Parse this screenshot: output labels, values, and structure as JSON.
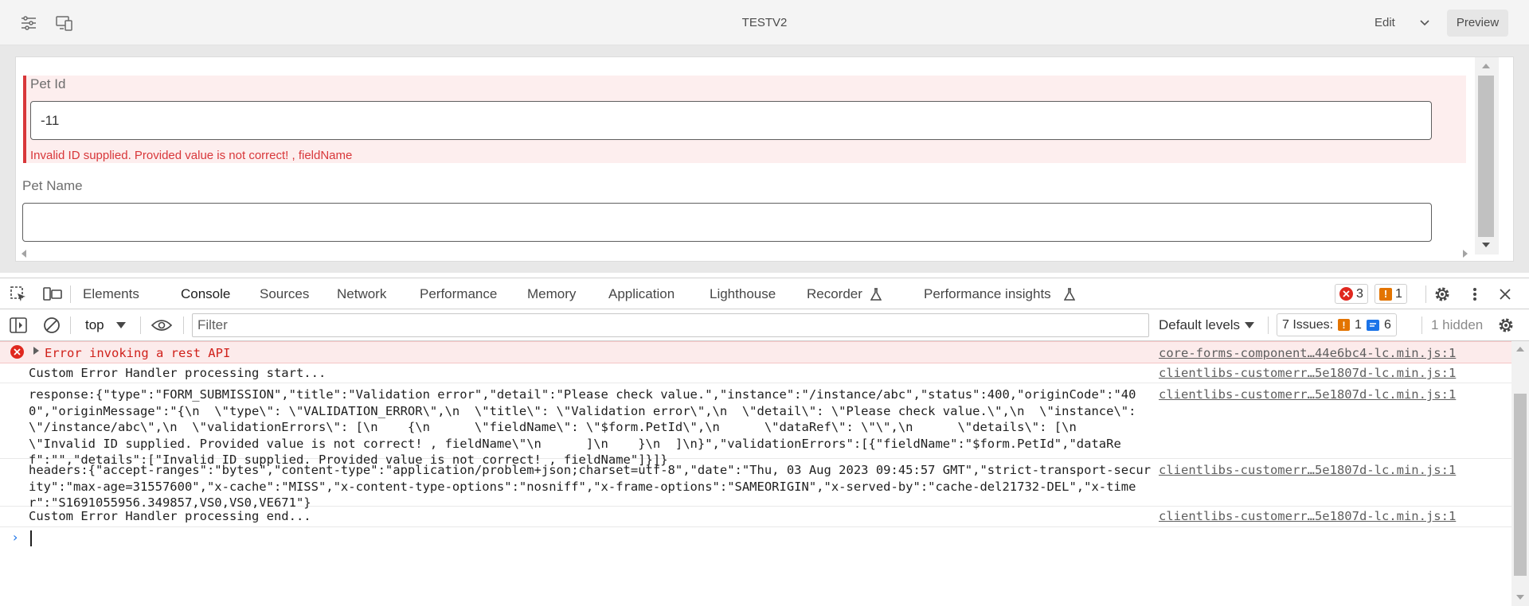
{
  "editor": {
    "title": "TESTV2",
    "edit_label": "Edit",
    "preview_label": "Preview",
    "icons": [
      "sliders-icon",
      "device-emulator-icon",
      "chevron-down-icon"
    ]
  },
  "form": {
    "pet_id": {
      "label": "Pet Id",
      "value": "-11",
      "error": "Invalid ID supplied. Provided value is not correct! , fieldName"
    },
    "pet_name": {
      "label": "Pet Name",
      "value": ""
    }
  },
  "devtools": {
    "tabs": [
      "Elements",
      "Console",
      "Sources",
      "Network",
      "Performance",
      "Memory",
      "Application",
      "Lighthouse",
      "Recorder",
      "Performance insights"
    ],
    "active_tab": "Console",
    "error_count": "3",
    "warning_count": "1",
    "toolbar": {
      "context": "top",
      "filter_placeholder": "Filter",
      "levels": "Default levels",
      "issues_label": "7 Issues:",
      "issues_warn": "1",
      "issues_info": "6",
      "hidden": "1 hidden"
    },
    "console": [
      {
        "level": "error",
        "message": "Error invoking a rest API",
        "source": "core-forms-component…44e6bc4-lc.min.js:1"
      },
      {
        "level": "log",
        "message": "Custom Error Handler processing start...",
        "source": "clientlibs-customerr…5e1807d-lc.min.js:1"
      },
      {
        "level": "log",
        "message": "response:{\"type\":\"FORM_SUBMISSION\",\"title\":\"Validation error\",\"detail\":\"Please check value.\",\"instance\":\"/instance/abc\",\"status\":400,\"originCode\":\"400\",\"originMessage\":\"{\\n  \\\"type\\\": \\\"VALIDATION_ERROR\\\",\\n  \\\"title\\\": \\\"Validation error\\\",\\n  \\\"detail\\\": \\\"Please check value.\\\",\\n  \\\"instance\\\": \\\"/instance/abc\\\",\\n  \\\"validationErrors\\\": [\\n    {\\n      \\\"fieldName\\\": \\\"$form.PetId\\\",\\n      \\\"dataRef\\\": \\\"\\\",\\n      \\\"details\\\": [\\n        \\\"Invalid ID supplied. Provided value is not correct! , fieldName\\\"\\n      ]\\n    }\\n  ]\\n}\",\"validationErrors\":[{\"fieldName\":\"$form.PetId\",\"dataRef\":\"\",\"details\":[\"Invalid ID supplied. Provided value is not correct! , fieldName\"]}]}",
        "source": "clientlibs-customerr…5e1807d-lc.min.js:1"
      },
      {
        "level": "log",
        "message": "headers:{\"accept-ranges\":\"bytes\",\"content-type\":\"application/problem+json;charset=utf-8\",\"date\":\"Thu, 03 Aug 2023 09:45:57 GMT\",\"strict-transport-security\":\"max-age=31557600\",\"x-cache\":\"MISS\",\"x-content-type-options\":\"nosniff\",\"x-frame-options\":\"SAMEORIGIN\",\"x-served-by\":\"cache-del21732-DEL\",\"x-timer\":\"S1691055956.349857,VS0,VS0,VE671\"}",
        "source": "clientlibs-customerr…5e1807d-lc.min.js:1"
      },
      {
        "level": "log",
        "message": "Custom Error Handler processing end...",
        "source": "clientlibs-customerr…5e1807d-lc.min.js:1"
      }
    ]
  },
  "colors": {
    "error": "#d8373a",
    "error_bg": "#fdeeee",
    "accent": "#1a73e8",
    "warning": "#e37400"
  }
}
